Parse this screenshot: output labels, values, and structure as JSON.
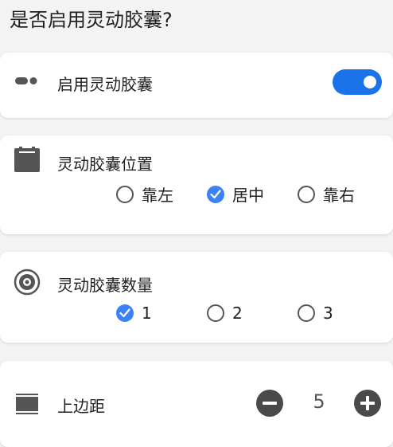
{
  "page": {
    "title": "是否启用灵动胶囊?"
  },
  "enable_section": {
    "icon": "capsule-dots-icon",
    "label": "启用灵动胶囊",
    "toggle_on": true
  },
  "position_section": {
    "icon": "calendar-icon",
    "label": "灵动胶囊位置",
    "options": [
      {
        "label": "靠左",
        "checked": false
      },
      {
        "label": "居中",
        "checked": true
      },
      {
        "label": "靠右",
        "checked": false
      }
    ]
  },
  "count_section": {
    "icon": "target-circle-icon",
    "label": "灵动胶囊数量",
    "options": [
      {
        "label": "1",
        "checked": true
      },
      {
        "label": "2",
        "checked": false
      },
      {
        "label": "3",
        "checked": false
      }
    ]
  },
  "margin_section": {
    "icon": "window-frame-icon",
    "label": "上边距",
    "value": "5"
  },
  "colors": {
    "accent": "#1a73e8",
    "radio_checked": "#3c82f6",
    "stepper_button": "#4a4a4a",
    "background": "#f3f3f3"
  }
}
